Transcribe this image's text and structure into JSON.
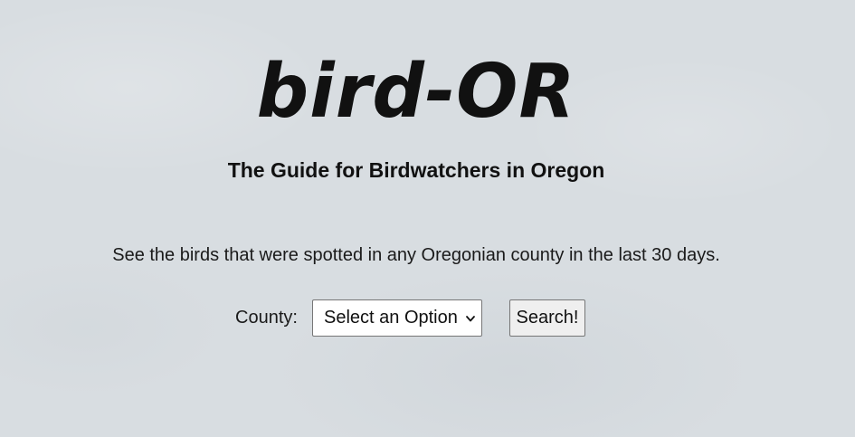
{
  "header": {
    "logo": "bird-OR",
    "tagline": "The Guide for Birdwatchers in Oregon"
  },
  "main": {
    "description": "See the birds that were spotted in any Oregonian county in the last 30 days.",
    "county_label": "County:",
    "county_select": {
      "selected": "Select an Option"
    },
    "search_button": "Search!"
  },
  "colors": {
    "background": "#d8dde1",
    "text": "#111111",
    "button_bg": "#efefef",
    "border": "#767676"
  },
  "icons": {
    "select_arrow": "chevron-down-icon"
  }
}
